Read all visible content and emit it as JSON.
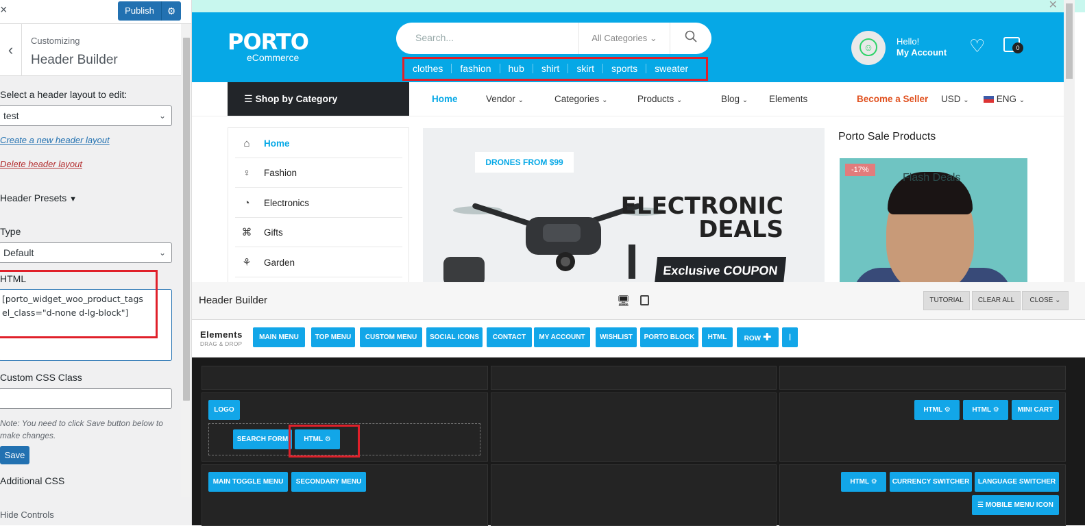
{
  "customizer": {
    "close_icon": "×",
    "publish_label": "Publish",
    "customizing_label": "Customizing",
    "section_title": "Header Builder",
    "layout_label": "Select a header layout to edit:",
    "layout_value": "test",
    "create_link": "Create a new header layout",
    "delete_link": "Delete header layout",
    "presets_label": "Header Presets",
    "type_label": "Type",
    "type_value": "Default",
    "html_label": "HTML",
    "html_value_line1": "[porto_widget_woo_product_tags",
    "html_value_line2": "el_class=\"d-none d-lg-block\"]",
    "css_class_label": "Custom CSS Class",
    "note": "Note: You need to click Save button below to make changes.",
    "save_label": "Save",
    "additional_css_label": "Additional CSS",
    "hide_controls_label": "Hide Controls"
  },
  "site": {
    "logo_main": "PORTO",
    "logo_sub": "eCommerce",
    "search_placeholder": "Search...",
    "search_category": "All Categories",
    "tags": [
      "clothes",
      "fashion",
      "hub",
      "shirt",
      "skirt",
      "sports",
      "sweater"
    ],
    "hello": "Hello!",
    "my_account": "My Account",
    "cart_count": "0",
    "shop_by_category": "Shop by Category",
    "nav": {
      "home": "Home",
      "vendor": "Vendor",
      "categories": "Categories",
      "products": "Products",
      "blog": "Blog",
      "elements": "Elements",
      "become_seller": "Become a Seller",
      "currency": "USD",
      "language": "ENG"
    },
    "category_list": [
      {
        "label": "Home",
        "icon": "home-icon"
      },
      {
        "label": "Fashion",
        "icon": "dress-icon"
      },
      {
        "label": "Electronics",
        "icon": "gauge-icon"
      },
      {
        "label": "Gifts",
        "icon": "gift-icon"
      },
      {
        "label": "Garden",
        "icon": "plant-icon"
      }
    ],
    "banner": {
      "tag": "DRONES FROM $99",
      "title_line1": "ELECTRONIC",
      "title_line2": "DEALS",
      "coupon": "Exclusive COUPON"
    },
    "sale": {
      "title": "Porto Sale Products",
      "discount": "-17%",
      "flash": "Flash Deals"
    }
  },
  "builder": {
    "title": "Header Builder",
    "tutorial": "TUTORIAL",
    "clear_all": "CLEAR ALL",
    "close": "CLOSE",
    "elements_title": "Elements",
    "elements_sub": "DRAG & DROP",
    "elements": [
      "MAIN MENU",
      "TOP MENU",
      "CUSTOM MENU",
      "SOCIAL ICONS",
      "CONTACT",
      "MY ACCOUNT",
      "WISHLIST",
      "PORTO BLOCK",
      "HTML",
      "ROW",
      "|"
    ],
    "row2_left": [
      "LOGO",
      "SEARCH FORM",
      "HTML"
    ],
    "row2_right": [
      "HTML",
      "HTML",
      "MINI CART"
    ],
    "row3_left": [
      "MAIN TOGGLE MENU",
      "SECONDARY MENU"
    ],
    "row3_right": [
      "HTML",
      "CURRENCY SWITCHER",
      "LANGUAGE SWITCHER",
      "MOBILE MENU ICON"
    ]
  },
  "colors": {
    "wp_blue": "#2271b1",
    "porto_blue": "#06a8e6",
    "builder_blue": "#12a6e8",
    "highlight_red": "#e0202a",
    "seller_orange": "#e0501e"
  }
}
